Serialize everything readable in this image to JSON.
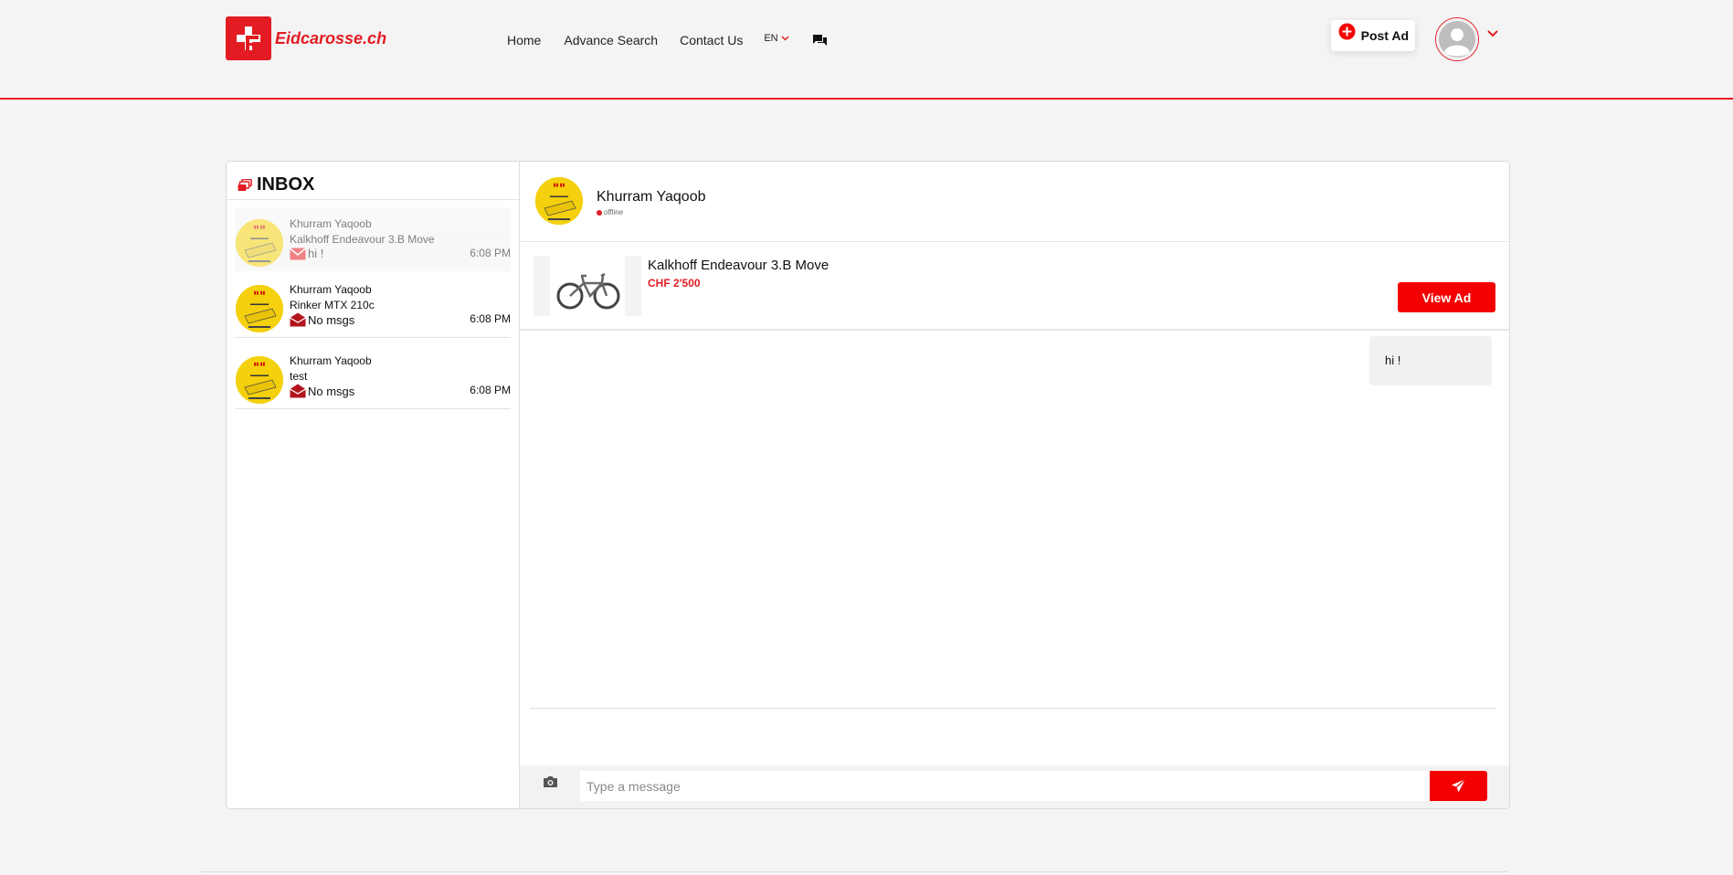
{
  "brand": {
    "name": "Eidcarosse.ch",
    "accent": "#e31c23"
  },
  "nav": {
    "home": "Home",
    "advance_search": "Advance Search",
    "contact_us": "Contact Us",
    "language": "EN",
    "chat_icon": "chat-icon"
  },
  "header": {
    "post_ad": "Post Ad"
  },
  "inbox": {
    "title": "INBOX",
    "conversations": [
      {
        "name": "Khurram Yaqoob",
        "ad": "Kalkhoff Endeavour 3.B Move",
        "message": "hi !",
        "time": "6:08 PM"
      },
      {
        "name": "Khurram Yaqoob",
        "ad": "Rinker MTX 210c",
        "message": "No msgs",
        "time": "6:08 PM"
      },
      {
        "name": "Khurram Yaqoob",
        "ad": "test",
        "message": "No msgs",
        "time": "6:08 PM"
      }
    ]
  },
  "chat": {
    "contact_name": "Khurram Yaqoob",
    "status": "offline",
    "ad_title": "Kalkhoff Endeavour 3.B Move",
    "ad_price": "CHF 2'500",
    "view_ad": "View Ad",
    "messages": [
      {
        "text": "hi !"
      }
    ],
    "input_placeholder": "Type a message"
  }
}
